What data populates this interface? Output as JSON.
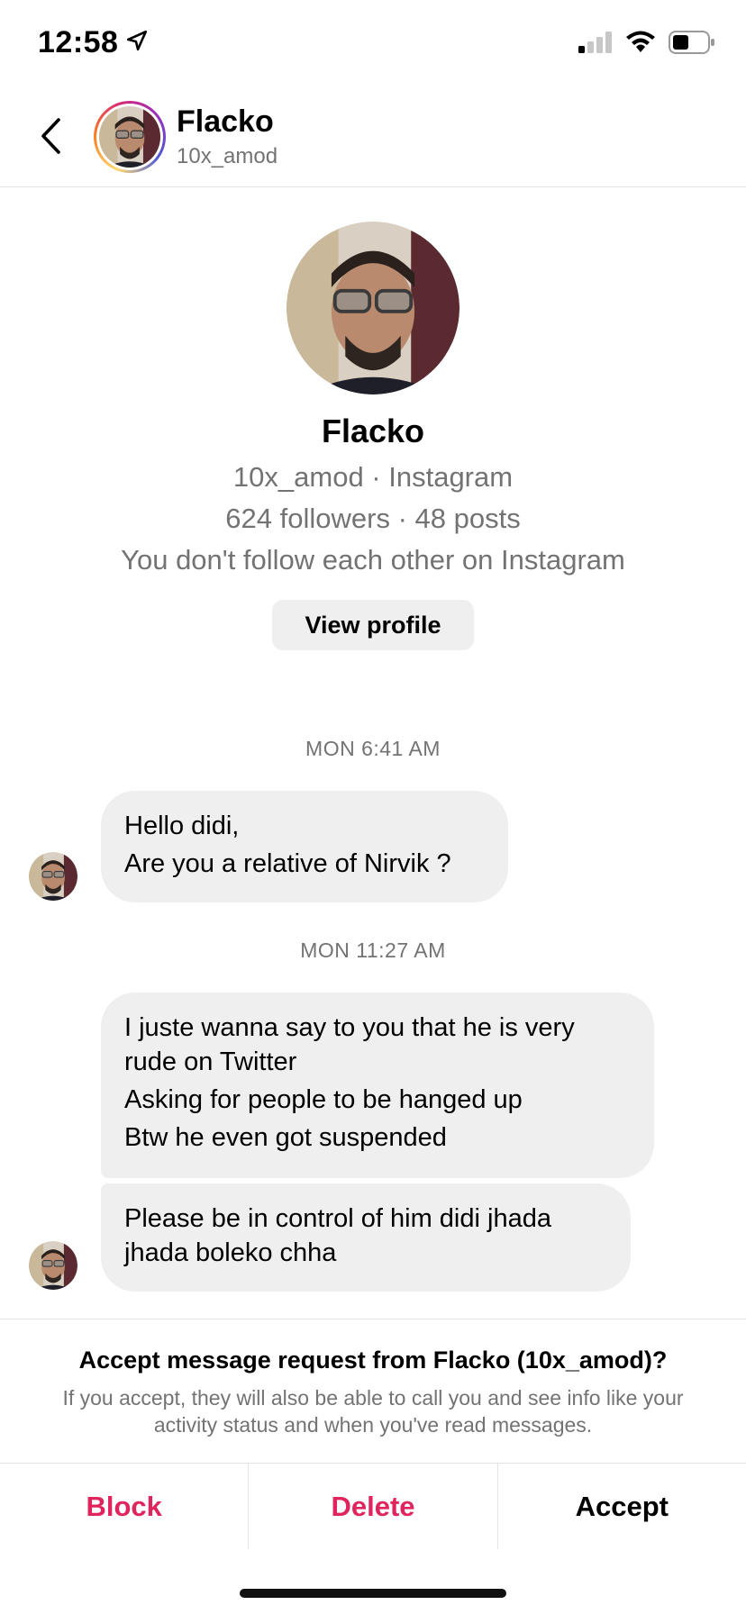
{
  "status_bar": {
    "time": "12:58",
    "location_icon": "location-arrow-icon",
    "signal_icon": "cellular-signal-icon",
    "wifi_icon": "wifi-icon",
    "battery_icon": "battery-icon"
  },
  "header": {
    "back_icon": "chevron-left-icon",
    "name": "Flacko",
    "handle": "10x_amod"
  },
  "profile": {
    "name": "Flacko",
    "handle_line": "10x_amod · Instagram",
    "stats_line": "624 followers · 48 posts",
    "follow_line": "You don't follow each other on Instagram",
    "view_profile_label": "View profile"
  },
  "messages": [
    {
      "timestamp": "MON 6:41 AM",
      "bubbles": [
        {
          "lines": [
            "Hello didi,",
            "Are you a relative of Nirvik ?"
          ]
        }
      ]
    },
    {
      "timestamp": "MON 11:27 AM",
      "bubbles": [
        {
          "lines": [
            "I juste wanna say to you that he is very",
            "rude on Twitter",
            "Asking for people to be hanged up",
            "Btw he even got suspended"
          ]
        },
        {
          "lines": [
            "Please be in control of him didi jhada",
            "jhada boleko chha"
          ]
        }
      ]
    }
  ],
  "request": {
    "title": "Accept message request from Flacko (10x_amod)?",
    "description": "If you accept, they will also be able to call you and see info like your activity status and when you've read messages."
  },
  "actions": {
    "block": "Block",
    "delete": "Delete",
    "accept": "Accept"
  },
  "colors": {
    "destructive": "#e0245e",
    "bubble": "#efefef",
    "secondary_text": "#737373"
  }
}
